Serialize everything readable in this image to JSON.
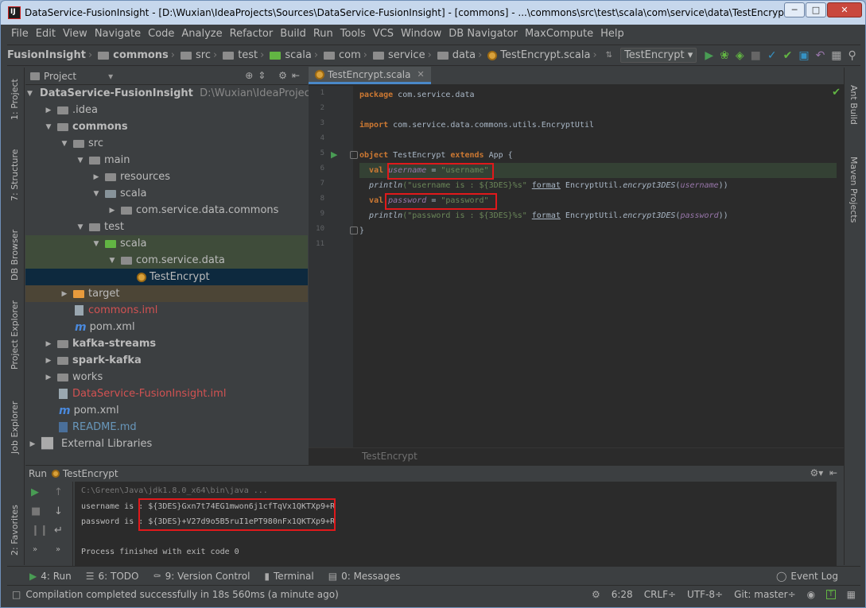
{
  "window": {
    "title": "DataService-FusionInsight - [D:\\Wuxian\\IdeaProjects\\Sources\\DataService-FusionInsight] - [commons] - ...\\commons\\src\\test\\scala\\com\\service\\data\\TestEncrypt.s..."
  },
  "menu": [
    "File",
    "Edit",
    "View",
    "Navigate",
    "Code",
    "Analyze",
    "Refactor",
    "Build",
    "Run",
    "Tools",
    "VCS",
    "Window",
    "DB Navigator",
    "MaxCompute",
    "Help"
  ],
  "breadcrumbs": [
    "FusionInsight",
    "commons",
    "src",
    "test",
    "scala",
    "com",
    "service",
    "data",
    "TestEncrypt.scala"
  ],
  "run_config": "TestEncrypt",
  "project_panel": {
    "title": "Project",
    "tree": [
      {
        "label": "DataService-FusionInsight",
        "extra": "D:\\Wuxian\\IdeaProjects\\S"
      },
      {
        "label": ".idea"
      },
      {
        "label": "commons"
      },
      {
        "label": "src"
      },
      {
        "label": "main"
      },
      {
        "label": "resources"
      },
      {
        "label": "scala"
      },
      {
        "label": "com.service.data.commons"
      },
      {
        "label": "test"
      },
      {
        "label": "scala"
      },
      {
        "label": "com.service.data"
      },
      {
        "label": "TestEncrypt"
      },
      {
        "label": "target"
      },
      {
        "label": "commons.iml"
      },
      {
        "label": "pom.xml"
      },
      {
        "label": "kafka-streams"
      },
      {
        "label": "spark-kafka"
      },
      {
        "label": "works"
      },
      {
        "label": "DataService-FusionInsight.iml"
      },
      {
        "label": "pom.xml"
      },
      {
        "label": "README.md"
      },
      {
        "label": "External Libraries"
      }
    ]
  },
  "editor": {
    "tab": "TestEncrypt.scala",
    "line_numbers": [
      "1",
      "2",
      "3",
      "4",
      "5",
      "6",
      "7",
      "8",
      "9",
      "10",
      "11"
    ],
    "code": {
      "l1_kw": "package",
      "l1_rest": " com.service.data",
      "l3_kw": "import",
      "l3_rest": " com.service.data.commons.utils.EncryptUtil",
      "l5_kw1": "object",
      "l5_mid": " TestEncrypt ",
      "l5_kw2": "extends",
      "l5_rest": " App {",
      "l6_kw": "val",
      "l6_var": "username",
      "l6_eq": " = ",
      "l6_str": "\"username\"",
      "l7_fn": "println",
      "l7_str": "(\"username is : ${3DES}%s\"",
      "l7_fmt": "format",
      "l7_cls": " EncryptUtil.",
      "l7_call": "encrypt3DES",
      "l7_arg": "username",
      "l7_end": "))",
      "l8_kw": "val",
      "l8_var": "password",
      "l8_eq": " = ",
      "l8_str": "\"password\"",
      "l9_fn": "println",
      "l9_str": "(\"password is : ${3DES}%s\"",
      "l9_fmt": "format",
      "l9_cls": " EncryptUtil.",
      "l9_call": "encrypt3DES",
      "l9_arg": "password",
      "l9_end": "))",
      "l10": "}"
    },
    "footer_breadcrumb": "TestEncrypt"
  },
  "run_panel": {
    "label": "Run",
    "config": "TestEncrypt",
    "console": {
      "cmd": "C:\\Green\\Java\\jdk1.8.0_x64\\bin\\java ...",
      "user_label": "username is : ",
      "user_value": "${3DES}Gxn7t74EG1mwon6j1cfTqVx1QKTXp9+R",
      "pass_label": "password is : ",
      "pass_value": "${3DES}+V27d9o5B5ruI1ePT980nFx1QKTXp9+R",
      "exit": "Process finished with exit code 0"
    }
  },
  "left_tool_tabs": [
    "1: Project",
    "7: Structure",
    "DB Browser",
    "Project Explorer",
    "Job Explorer",
    "2: Favorites"
  ],
  "right_tool_tabs": [
    "Ant Build",
    "Maven Projects"
  ],
  "bottom_tabs": [
    "4: Run",
    "6: TODO",
    "9: Version Control",
    "Terminal",
    "0: Messages",
    "Event Log"
  ],
  "status": {
    "message": "Compilation completed successfully in 18s 560ms (a minute ago)",
    "position": "6:28",
    "line_sep": "CRLF÷",
    "encoding": "UTF-8÷",
    "git": "Git: master÷"
  }
}
